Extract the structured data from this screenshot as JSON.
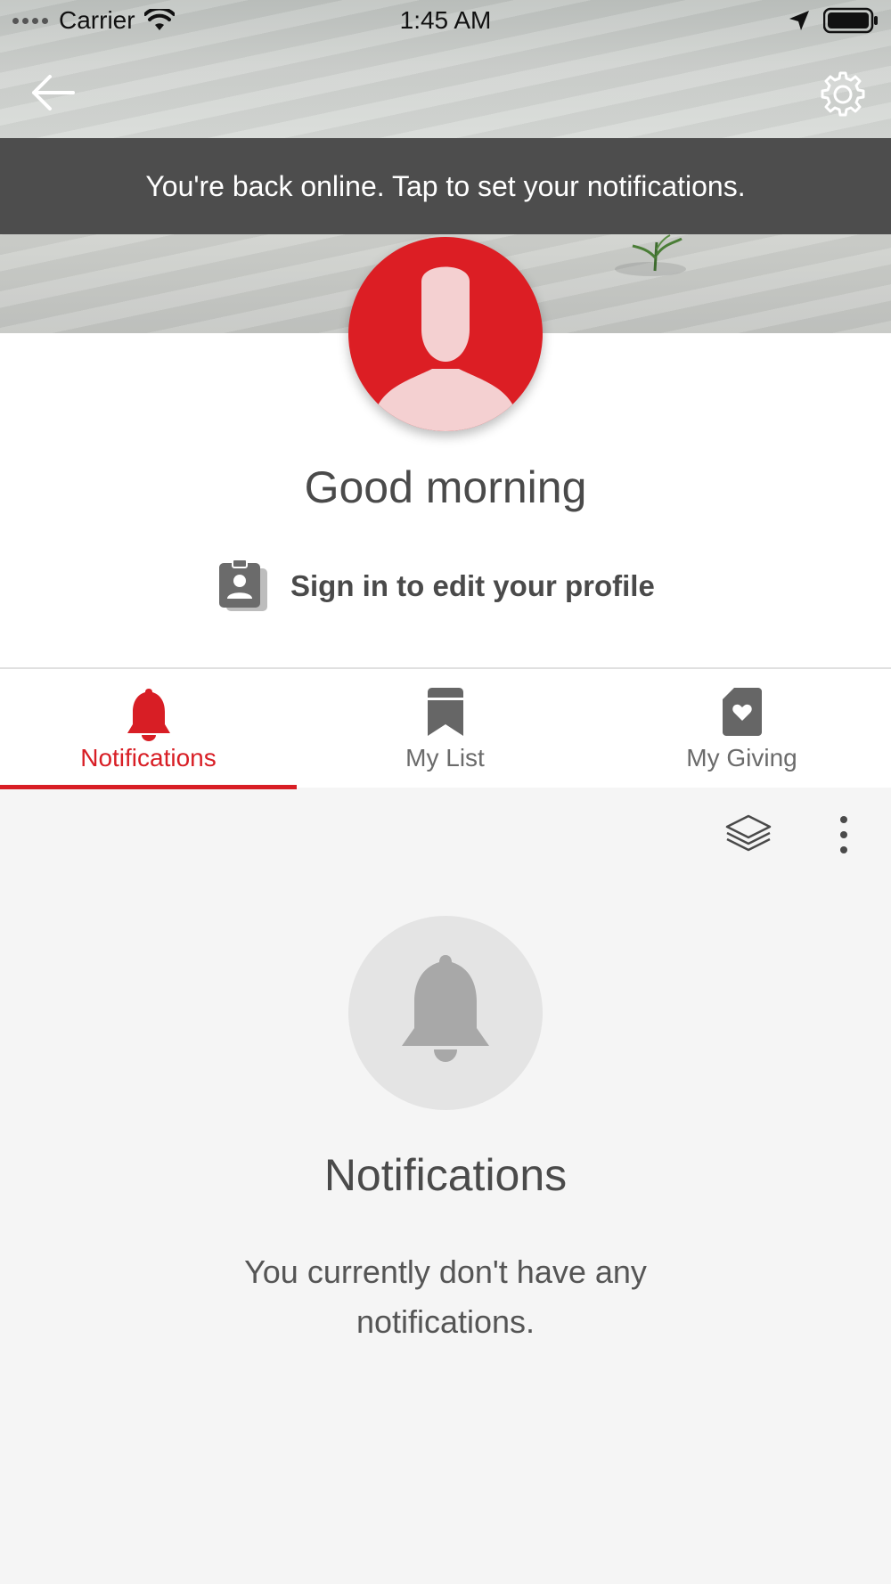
{
  "status_bar": {
    "carrier": "Carrier",
    "time": "1:45 AM"
  },
  "header": {
    "back_icon": "arrow-left-icon",
    "settings_icon": "gear-icon"
  },
  "banner": {
    "text": "You're back online. Tap to set your notifications."
  },
  "profile": {
    "avatar_icon": "person-silhouette-icon",
    "greeting": "Good morning",
    "signin_label": "Sign in to edit your profile",
    "signin_icon": "id-badge-icon"
  },
  "tabs": [
    {
      "label": "Notifications",
      "icon": "bell-icon",
      "active": true
    },
    {
      "label": "My List",
      "icon": "bookmark-icon",
      "active": false
    },
    {
      "label": "My Giving",
      "icon": "heart-document-icon",
      "active": false
    }
  ],
  "toolbar": {
    "layers_icon": "layers-icon",
    "more_icon": "more-vertical-icon"
  },
  "empty_state": {
    "icon": "bell-icon",
    "title": "Notifications",
    "message": "You currently don't have any notifications."
  },
  "colors": {
    "accent": "#d81e25",
    "banner_bg": "#4d4d4d",
    "text": "#4a4a4a"
  }
}
